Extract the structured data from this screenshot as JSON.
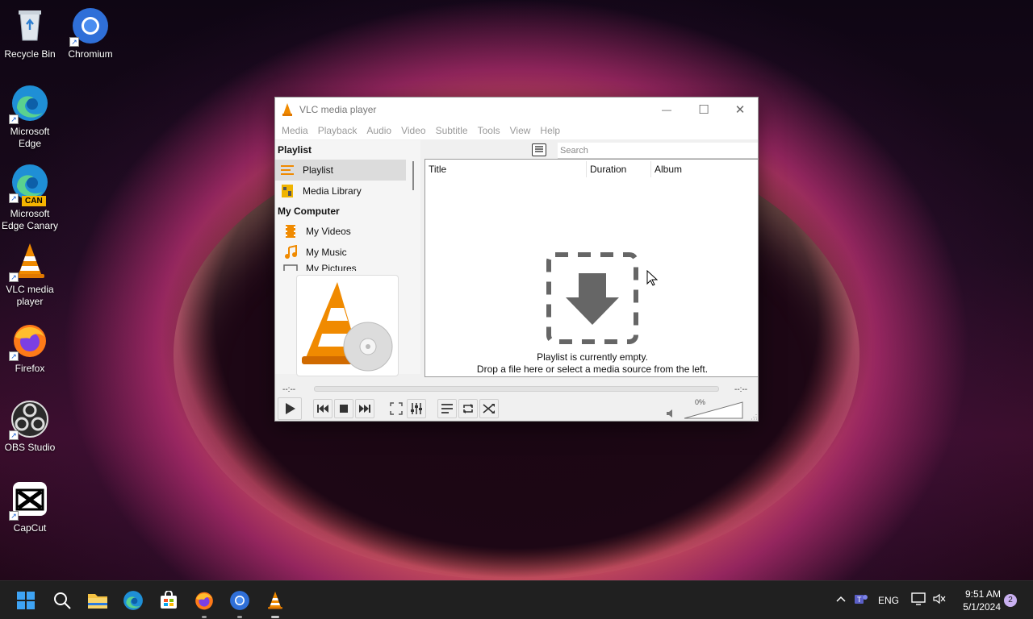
{
  "desktop": {
    "icons": [
      {
        "label": "Recycle Bin",
        "icon": "recycle-bin-icon"
      },
      {
        "label": "Chromium",
        "icon": "chromium-icon"
      },
      {
        "label": "Microsoft Edge",
        "icon": "edge-icon"
      },
      {
        "label": "Microsoft Edge Canary",
        "icon": "edge-canary-icon",
        "badge": "CAN"
      },
      {
        "label": "VLC media player",
        "icon": "vlc-icon"
      },
      {
        "label": "Firefox",
        "icon": "firefox-icon"
      },
      {
        "label": "OBS Studio",
        "icon": "obs-icon"
      },
      {
        "label": "CapCut",
        "icon": "capcut-icon"
      }
    ]
  },
  "vlc": {
    "title": "VLC media player",
    "window_controls": {
      "minimize": "—",
      "maximize": "☐",
      "close": "✕"
    },
    "menu": [
      "Media",
      "Playback",
      "Audio",
      "Video",
      "Subtitle",
      "Tools",
      "View",
      "Help"
    ],
    "sidebar": {
      "playlist_header": "Playlist",
      "playlist_items": [
        "Playlist",
        "Media Library"
      ],
      "computer_header": "My Computer",
      "computer_items": [
        "My Videos",
        "My Music",
        "My Pictures"
      ]
    },
    "search_placeholder": "Search",
    "columns": [
      "Title",
      "Duration",
      "Album"
    ],
    "empty_line1": "Playlist is currently empty.",
    "empty_line2": "Drop a file here or select a media source from the left.",
    "time_elapsed": "--:--",
    "time_total": "--:--",
    "volume_label": "0%",
    "volume_level": 0
  },
  "taskbar": {
    "apps": [
      "start-icon",
      "search-icon",
      "file-explorer-icon",
      "edge-icon",
      "store-icon",
      "firefox-icon",
      "chromium-icon",
      "vlc-icon"
    ],
    "language": "ENG",
    "time": "9:51 AM",
    "date": "5/1/2024",
    "notification_count": "2"
  },
  "colors": {
    "vlc_orange": "#f08a00",
    "taskbar": "#202020",
    "accent_blue": "#0a64d8"
  }
}
